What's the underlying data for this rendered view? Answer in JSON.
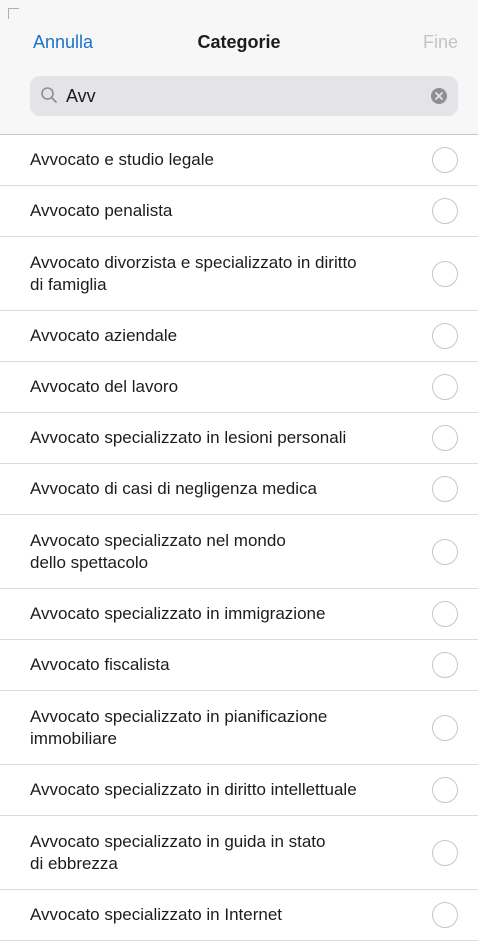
{
  "nav": {
    "cancel_label": "Annulla",
    "title": "Categorie",
    "done_label": "Fine"
  },
  "search": {
    "value": "Avv",
    "icon": "search-icon",
    "clear_icon": "clear-icon"
  },
  "colors": {
    "accent": "#1a73c9",
    "disabled": "#c4c4c6",
    "header_bg": "#f7f7f7",
    "separator": "#dcdcdf"
  },
  "categories": [
    {
      "label": "Avvocato e studio legale",
      "selected": false
    },
    {
      "label": "Avvocato penalista",
      "selected": false
    },
    {
      "label": "Avvocato divorzista e specializzato in diritto\ndi famiglia",
      "selected": false
    },
    {
      "label": "Avvocato aziendale",
      "selected": false
    },
    {
      "label": "Avvocato del lavoro",
      "selected": false
    },
    {
      "label": "Avvocato specializzato in lesioni personali",
      "selected": false
    },
    {
      "label": "Avvocato di casi di negligenza medica",
      "selected": false
    },
    {
      "label": "Avvocato specializzato nel mondo\ndello spettacolo",
      "selected": false
    },
    {
      "label": "Avvocato specializzato in immigrazione",
      "selected": false
    },
    {
      "label": "Avvocato fiscalista",
      "selected": false
    },
    {
      "label": "Avvocato specializzato in pianificazione\nimmobiliare",
      "selected": false
    },
    {
      "label": "Avvocato specializzato in diritto intellettuale",
      "selected": false
    },
    {
      "label": "Avvocato specializzato in guida in stato\ndi ebbrezza",
      "selected": false
    },
    {
      "label": "Avvocato specializzato in Internet",
      "selected": false
    }
  ]
}
